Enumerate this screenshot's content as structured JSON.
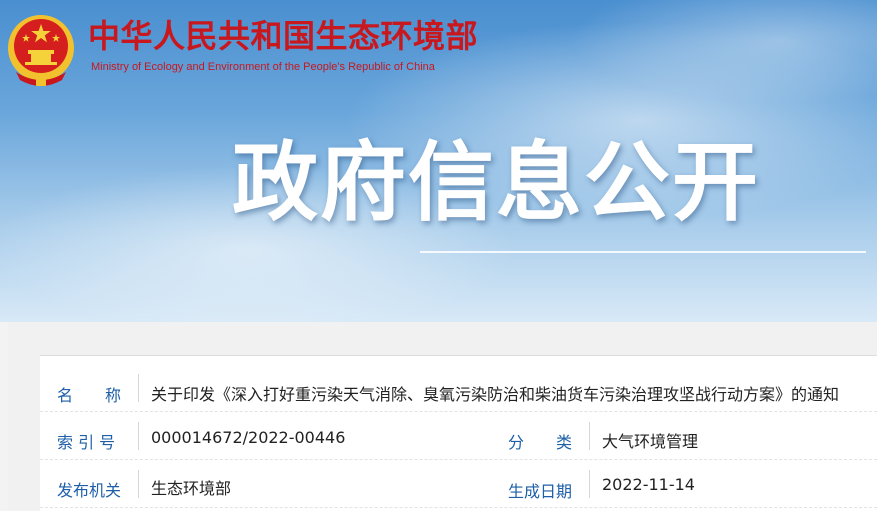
{
  "header": {
    "ministry_cn": "中华人民共和国生态环境部",
    "ministry_en": "Ministry of Ecology and Environment of the People's Republic of China",
    "headline": "政府信息公开",
    "emblem_icon": "national-emblem-icon"
  },
  "info": {
    "name_label": "名　　称",
    "name_value": "关于印发《深入打好重污染天气消除、臭氧污染防治和柴油货车污染治理攻坚战行动方案》的通知",
    "index_label": "索 引 号",
    "index_value": "000014672/2022-00446",
    "category_label": "分　　类",
    "category_value": "大气环境管理",
    "issuer_label": "发布机关",
    "issuer_value": "生态环境部",
    "date_label": "生成日期",
    "date_value": "2022-11-14"
  },
  "colors": {
    "brand_red": "#c8171d",
    "label_blue": "#1e5fa8",
    "emblem_gold": "#f2c12e"
  }
}
